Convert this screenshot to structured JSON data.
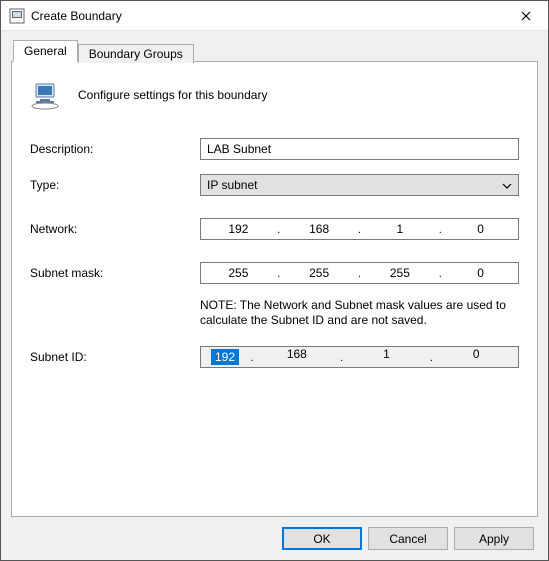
{
  "window": {
    "title": "Create Boundary"
  },
  "tabs": {
    "general": "General",
    "boundary_groups": "Boundary Groups"
  },
  "header": {
    "text": "Configure settings for this boundary"
  },
  "labels": {
    "description": "Description:",
    "type": "Type:",
    "network": "Network:",
    "subnet_mask": "Subnet mask:",
    "subnet_id": "Subnet ID:"
  },
  "fields": {
    "description_value": "LAB Subnet",
    "type_value": "IP subnet",
    "network": {
      "o1": "192",
      "o2": "168",
      "o3": "1",
      "o4": "0"
    },
    "subnet_mask": {
      "o1": "255",
      "o2": "255",
      "o3": "255",
      "o4": "0"
    },
    "subnet_id": {
      "o1": "192",
      "o2": "168",
      "o3": "1",
      "o4": "0"
    }
  },
  "note": "NOTE: The Network and Subnet mask values are used to calculate the Subnet ID and are not saved.",
  "buttons": {
    "ok": "OK",
    "cancel": "Cancel",
    "apply": "Apply"
  }
}
